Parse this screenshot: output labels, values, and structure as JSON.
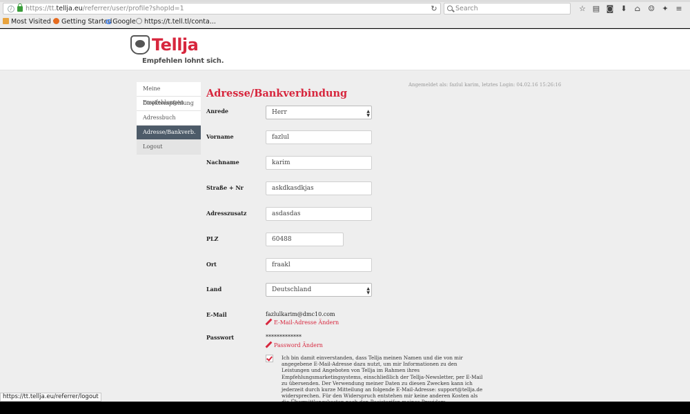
{
  "browser": {
    "url_prefix": "https://tt.",
    "url_host": "tellja.eu",
    "url_path": "/referrer/user/profile?shopId=1",
    "search_placeholder": "Search",
    "bookmarks": [
      {
        "label": "Most Visited ▾",
        "icon": "folder-icon"
      },
      {
        "label": "Getting Started",
        "icon": "firefox-icon"
      },
      {
        "label": "Google",
        "icon": "google-icon"
      },
      {
        "label": "https://t.tell.tl/conta...",
        "icon": "globe-icon"
      }
    ],
    "status_url": "https://tt.tellja.eu/referrer/logout"
  },
  "header": {
    "logo_text": "Tellja",
    "tagline": "Empfehlen lohnt sich."
  },
  "sidebar": {
    "items": [
      {
        "label": "Meine Empfehlungen"
      },
      {
        "label": "Direktempfehlung"
      },
      {
        "label": "Adressbuch"
      },
      {
        "label": "Adresse/Bankverb."
      },
      {
        "label": "Logout"
      }
    ]
  },
  "main": {
    "login_info": "Angemeldet als: fazlul karim, letztes Login: 04.02.16 15:26:16",
    "title": "Adresse/Bankverbindung",
    "fields": {
      "anrede": {
        "label": "Anrede",
        "value": "Herr"
      },
      "vorname": {
        "label": "Vorname",
        "value": "fazlul"
      },
      "nachname": {
        "label": "Nachname",
        "value": "karim"
      },
      "strasse": {
        "label": "Straße + Nr",
        "value": "askdkasdkjas"
      },
      "adresszusatz": {
        "label": "Adresszusatz",
        "value": "asdasdas"
      },
      "plz": {
        "label": "PLZ",
        "value": "60488"
      },
      "ort": {
        "label": "Ort",
        "value": "fraakl"
      },
      "land": {
        "label": "Land",
        "value": "Deutschland"
      }
    },
    "email": {
      "label": "E-Mail",
      "value": "fazlulkarim@dmc10.com",
      "edit_label": "E-Mail-Adresse Ändern"
    },
    "password": {
      "label": "Passwort",
      "value": "*************",
      "edit_label": "Password Ändern"
    },
    "consent_checked": true,
    "consent_text": "Ich bin damit einverstanden, dass Tellja meinen Namen und die von mir angegebene E-Mail-Adresse dazu nutzt, um mir Informationen zu den Leistungen und Angeboten von Tellja im Rahmen ihres Empfehlungsmarketingsystems, einschließlich der Tellja-Newsletter, per E-Mail zu übersenden. Der Verwendung meiner Daten zu diesen Zwecken kann ich jederzeit durch kurze Mitteilung an folgende E-Mail-Adresse: support@tellja.de widersprechen. Für den Widerspruch entstehen mir keine anderen Kosten als die Übermittlungskosten nach den Basistarifen meines Providers."
  },
  "colors": {
    "brand": "#d7263d",
    "sidebar_active": "#4d5b69",
    "page_bg": "#eeeeee"
  }
}
